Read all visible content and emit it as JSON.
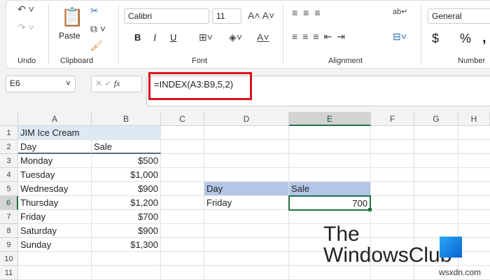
{
  "ribbon": {
    "undo_label": "Undo",
    "clipboard_label": "Clipboard",
    "paste_label": "Paste",
    "font_label": "Font",
    "alignment_label": "Alignment",
    "number_label": "Number",
    "font_name": "Calibri",
    "font_size": "11",
    "number_format": "General",
    "bold": "B",
    "italic": "I",
    "underline": "U",
    "currency": "$",
    "percent": "%",
    "comma": ","
  },
  "formula_bar": {
    "name_box": "E6",
    "fx": "fx",
    "formula": "=INDEX(A3:B9,5,2)",
    "highlight_color": "#d9141b"
  },
  "columns": [
    "A",
    "B",
    "C",
    "D",
    "E",
    "F",
    "G",
    "H"
  ],
  "rows": [
    "1",
    "2",
    "3",
    "4",
    "5",
    "6",
    "7",
    "8",
    "9",
    "10",
    "11"
  ],
  "table": {
    "title": "JIM Ice Cream",
    "headers": [
      "Day",
      "Sale"
    ],
    "rows": [
      [
        "Monday",
        "$500"
      ],
      [
        "Tuesday",
        "$1,000"
      ],
      [
        "Wednesday",
        "$900"
      ],
      [
        "Thursday",
        "$1,200"
      ],
      [
        "Friday",
        "$700"
      ],
      [
        "Saturday",
        "$900"
      ],
      [
        "Sunday",
        "$1,300"
      ]
    ]
  },
  "lookup": {
    "headers": [
      "Day",
      "Sale"
    ],
    "day": "Friday",
    "sale": "700"
  },
  "watermark": {
    "line1": "The",
    "line2": "WindowsClub",
    "site": "wsxdn.com"
  }
}
